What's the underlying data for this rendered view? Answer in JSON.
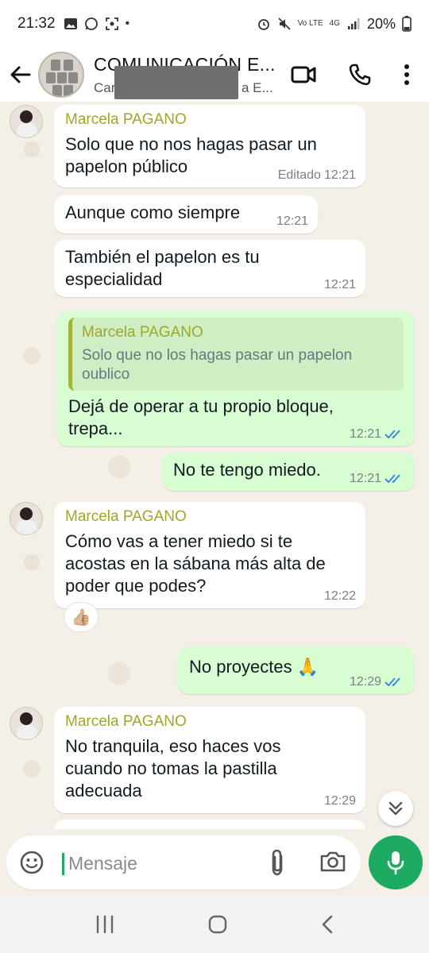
{
  "status_bar": {
    "time": "21:32",
    "battery": "20%",
    "network_small": "Vo LTE",
    "network_type": "4G"
  },
  "header": {
    "title": "COMUNICACIÓN E...",
    "subtitle_left": "Car",
    "subtitle_right": "a E..."
  },
  "messages": [
    {
      "id": "m1",
      "direction": "in",
      "sender": "Marcela PAGANO",
      "text": "Solo que no nos hagas pasar un papelon público",
      "edited_label": "Editado",
      "time": "12:21"
    },
    {
      "id": "m2",
      "direction": "in",
      "text": "Aunque como siempre",
      "time": "12:21"
    },
    {
      "id": "m3",
      "direction": "in",
      "text": "También el papelon es tu especialidad",
      "time": "12:21"
    },
    {
      "id": "m4",
      "direction": "out",
      "quote_sender": "Marcela PAGANO",
      "quote_text": "Solo que no los hagas pasar un papelon oublico",
      "text": "Dejá de operar a tu propio bloque, trepa...",
      "time": "12:21"
    },
    {
      "id": "m5",
      "direction": "out",
      "text": "No te tengo miedo.",
      "time": "12:21"
    },
    {
      "id": "m6",
      "direction": "in",
      "sender": "Marcela PAGANO",
      "text": "Cómo vas a tener miedo si te acostas en la sábana más alta de poder que podes?",
      "time": "12:22",
      "reaction": "👍🏼"
    },
    {
      "id": "m7",
      "direction": "out",
      "text": "No proyectes 🙏",
      "time": "12:29"
    },
    {
      "id": "m8",
      "direction": "in",
      "sender": "Marcela PAGANO",
      "text": "No tranquila, eso haces vos cuando no tomas la pastilla adecuada",
      "time": "12:29"
    }
  ],
  "input": {
    "placeholder": "Mensaje"
  },
  "colors": {
    "accent_green": "#1daa61",
    "outgoing_bubble": "#d9fdd3",
    "sender_name": "#a0a626",
    "read_ticks": "#3a8bd8"
  }
}
